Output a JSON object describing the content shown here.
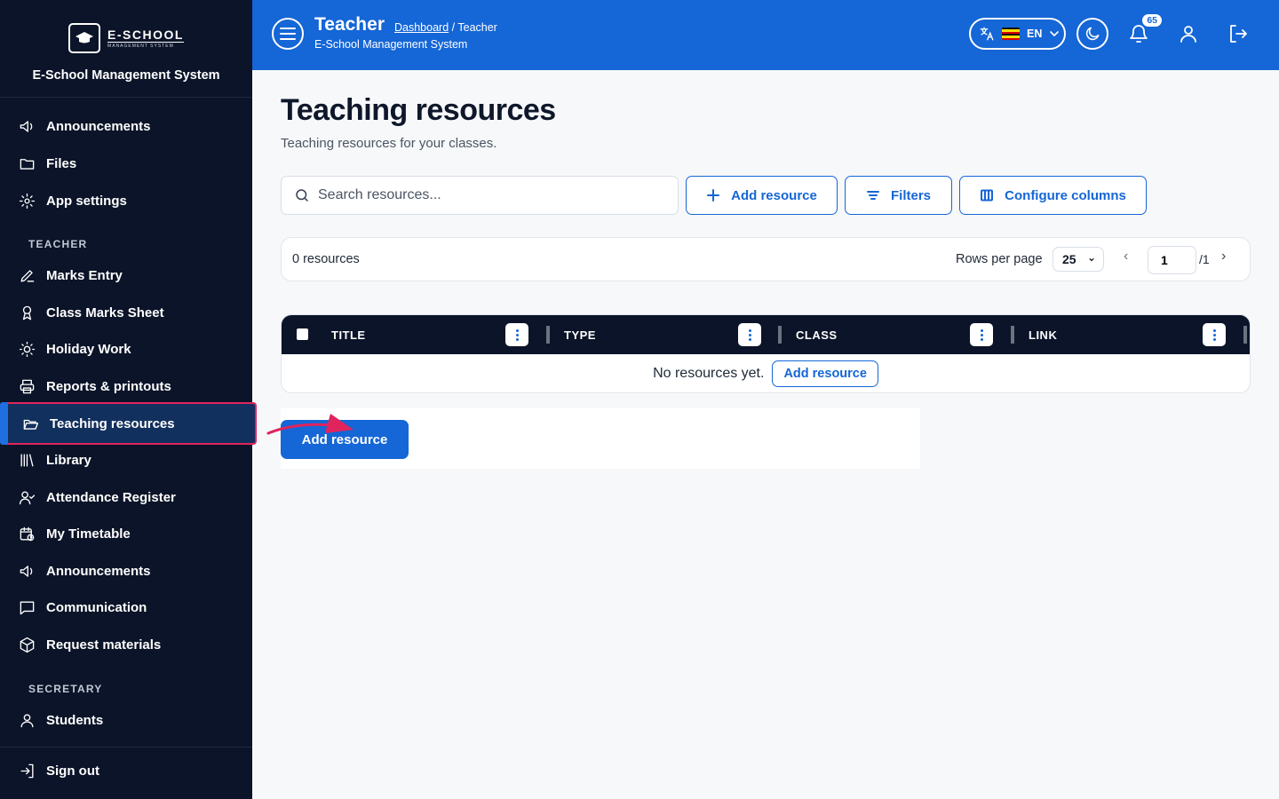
{
  "sidebar": {
    "logo_name": "E-SCHOOL",
    "logo_tagline": "MANAGEMENT SYSTEM",
    "app_name": "E-School Management System",
    "items_top": [
      {
        "label": "Announcements",
        "icon": "megaphone-icon"
      },
      {
        "label": "Files",
        "icon": "folder-icon"
      },
      {
        "label": "App settings",
        "icon": "gear-icon"
      }
    ],
    "section_teacher": "TEACHER",
    "items_teacher": [
      {
        "label": "Marks Entry",
        "icon": "pencil-icon"
      },
      {
        "label": "Class Marks Sheet",
        "icon": "award-icon"
      },
      {
        "label": "Holiday Work",
        "icon": "sun-icon"
      },
      {
        "label": "Reports & printouts",
        "icon": "printer-icon"
      },
      {
        "label": "Teaching resources",
        "icon": "folder-open-icon",
        "active": true
      },
      {
        "label": "Library",
        "icon": "library-icon"
      },
      {
        "label": "Attendance Register",
        "icon": "user-check-icon"
      },
      {
        "label": "My Timetable",
        "icon": "calendar-clock-icon"
      },
      {
        "label": "Announcements",
        "icon": "megaphone-icon"
      },
      {
        "label": "Communication",
        "icon": "message-icon"
      },
      {
        "label": "Request materials",
        "icon": "package-icon"
      }
    ],
    "section_secretary": "SECRETARY",
    "items_secretary": [
      {
        "label": "Students",
        "icon": "user-icon"
      }
    ],
    "sign_out": "Sign out"
  },
  "header": {
    "title": "Teacher",
    "breadcrumb_link": "Dashboard",
    "breadcrumb_current": "/ Teacher",
    "subtitle": "E-School Management System",
    "language": "EN",
    "notification_count": "65"
  },
  "main": {
    "title": "Teaching resources",
    "subtitle": "Teaching resources for your classes.",
    "search_placeholder": "Search resources...",
    "add_resource": "Add resource",
    "filters": "Filters",
    "configure_columns": "Configure columns",
    "count": "0 resources",
    "rows_per_page_label": "Rows per page",
    "rows_per_page": "25",
    "page": "1",
    "total_pages": "/1",
    "columns": [
      "TITLE",
      "TYPE",
      "CLASS",
      "LINK"
    ],
    "empty_text": "No resources yet.",
    "empty_action": "Add resource",
    "primary_action": "Add resource"
  },
  "colors": {
    "sidebar_bg": "#0b1428",
    "header_bg": "#1566d6",
    "accent": "#1566d6",
    "highlight_border": "#e0245e"
  }
}
